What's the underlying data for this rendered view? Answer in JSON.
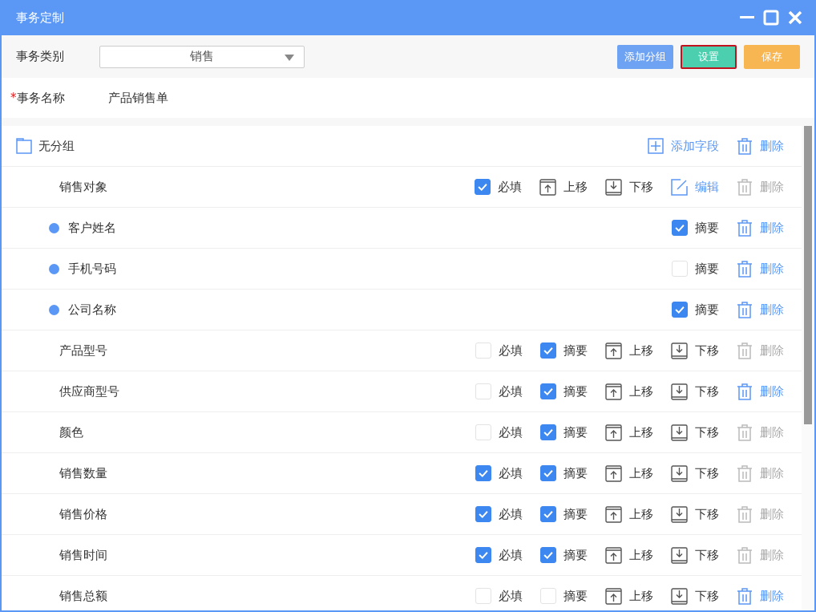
{
  "window": {
    "title": "事务定制"
  },
  "toolbar": {
    "category_label": "事务类别",
    "category_value": "销售",
    "buttons": [
      {
        "label": "添加分组",
        "kind": "add"
      },
      {
        "label": "设置",
        "kind": "settings",
        "selected": true
      },
      {
        "label": "保存",
        "kind": "save"
      }
    ]
  },
  "name_row": {
    "label": "事务名称",
    "required_mark": "*",
    "value": "产品销售单"
  },
  "group": {
    "title": "无分组",
    "actions": [
      {
        "kind": "add",
        "label": "添加字段"
      },
      {
        "kind": "delete",
        "label": "删除",
        "disabled": false
      }
    ]
  },
  "rows": [
    {
      "kind": "field",
      "label": "销售对象",
      "controls": [
        {
          "kind": "check",
          "label": "必填",
          "checked": true
        },
        {
          "kind": "up",
          "label": "上移"
        },
        {
          "kind": "down",
          "label": "下移"
        },
        {
          "kind": "edit",
          "label": "编辑"
        },
        {
          "kind": "delete",
          "label": "删除",
          "disabled": true
        }
      ]
    },
    {
      "kind": "sub",
      "label": "客户姓名",
      "controls": [
        {
          "kind": "check",
          "label": "摘要",
          "checked": true
        },
        {
          "kind": "delete",
          "label": "删除",
          "disabled": false
        }
      ]
    },
    {
      "kind": "sub",
      "label": "手机号码",
      "controls": [
        {
          "kind": "check",
          "label": "摘要",
          "checked": false
        },
        {
          "kind": "delete",
          "label": "删除",
          "disabled": false
        }
      ]
    },
    {
      "kind": "sub",
      "label": "公司名称",
      "controls": [
        {
          "kind": "check",
          "label": "摘要",
          "checked": true
        },
        {
          "kind": "delete",
          "label": "删除",
          "disabled": false
        }
      ]
    },
    {
      "kind": "field",
      "label": "产品型号",
      "controls": [
        {
          "kind": "check",
          "label": "必填",
          "checked": false
        },
        {
          "kind": "check",
          "label": "摘要",
          "checked": true
        },
        {
          "kind": "up",
          "label": "上移"
        },
        {
          "kind": "down",
          "label": "下移"
        },
        {
          "kind": "delete",
          "label": "删除",
          "disabled": true
        }
      ]
    },
    {
      "kind": "field",
      "label": "供应商型号",
      "controls": [
        {
          "kind": "check",
          "label": "必填",
          "checked": false
        },
        {
          "kind": "check",
          "label": "摘要",
          "checked": true
        },
        {
          "kind": "up",
          "label": "上移"
        },
        {
          "kind": "down",
          "label": "下移"
        },
        {
          "kind": "delete",
          "label": "删除",
          "disabled": false
        }
      ]
    },
    {
      "kind": "field",
      "label": "颜色",
      "controls": [
        {
          "kind": "check",
          "label": "必填",
          "checked": false
        },
        {
          "kind": "check",
          "label": "摘要",
          "checked": true
        },
        {
          "kind": "up",
          "label": "上移"
        },
        {
          "kind": "down",
          "label": "下移"
        },
        {
          "kind": "delete",
          "label": "删除",
          "disabled": true
        }
      ]
    },
    {
      "kind": "field",
      "label": "销售数量",
      "controls": [
        {
          "kind": "check",
          "label": "必填",
          "checked": true
        },
        {
          "kind": "check",
          "label": "摘要",
          "checked": true
        },
        {
          "kind": "up",
          "label": "上移"
        },
        {
          "kind": "down",
          "label": "下移"
        },
        {
          "kind": "delete",
          "label": "删除",
          "disabled": true
        }
      ]
    },
    {
      "kind": "field",
      "label": "销售价格",
      "controls": [
        {
          "kind": "check",
          "label": "必填",
          "checked": true
        },
        {
          "kind": "check",
          "label": "摘要",
          "checked": true
        },
        {
          "kind": "up",
          "label": "上移"
        },
        {
          "kind": "down",
          "label": "下移"
        },
        {
          "kind": "delete",
          "label": "删除",
          "disabled": true
        }
      ]
    },
    {
      "kind": "field",
      "label": "销售时间",
      "controls": [
        {
          "kind": "check",
          "label": "必填",
          "checked": true
        },
        {
          "kind": "check",
          "label": "摘要",
          "checked": true
        },
        {
          "kind": "up",
          "label": "上移"
        },
        {
          "kind": "down",
          "label": "下移"
        },
        {
          "kind": "delete",
          "label": "删除",
          "disabled": true
        }
      ]
    },
    {
      "kind": "field",
      "label": "销售总额",
      "controls": [
        {
          "kind": "check",
          "label": "必填",
          "checked": false
        },
        {
          "kind": "check",
          "label": "摘要",
          "checked": false
        },
        {
          "kind": "up",
          "label": "上移"
        },
        {
          "kind": "down",
          "label": "下移"
        },
        {
          "kind": "delete",
          "label": "删除",
          "disabled": false
        }
      ]
    }
  ]
}
